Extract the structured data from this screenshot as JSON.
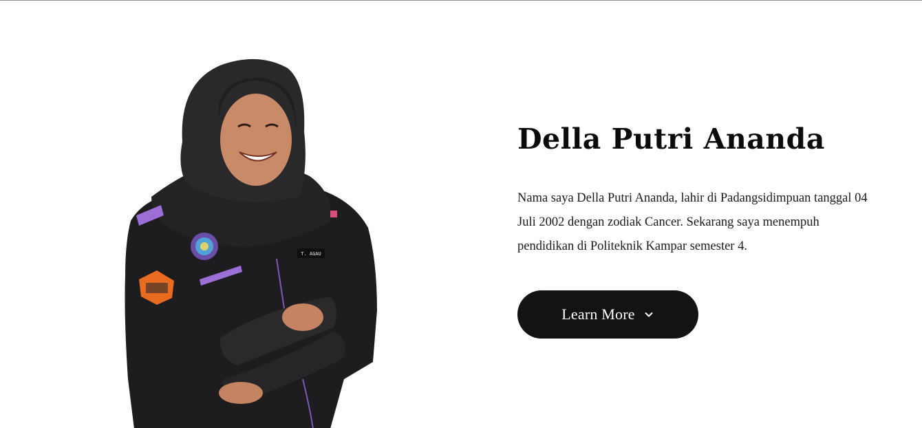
{
  "hero": {
    "title": "Della Putri Ananda",
    "description": "Nama saya Della Putri Ananda, lahir di Padangsidimpuan tanggal 04 Juli 2002 dengan zodiak Cancer. Sekarang saya menempuh pendidikan di Politeknik Kampar semester 4.",
    "button_label": "Learn More",
    "button_icon": "chevron-down-icon",
    "portrait_name_tag": "T. AGAU"
  },
  "colors": {
    "button_background": "#131313",
    "button_text": "#ffffff",
    "title_text": "#0b0b0b",
    "body_text": "#1a1a1a",
    "page_background": "#ffffff",
    "uniform_accent": "#9b6fd6"
  }
}
